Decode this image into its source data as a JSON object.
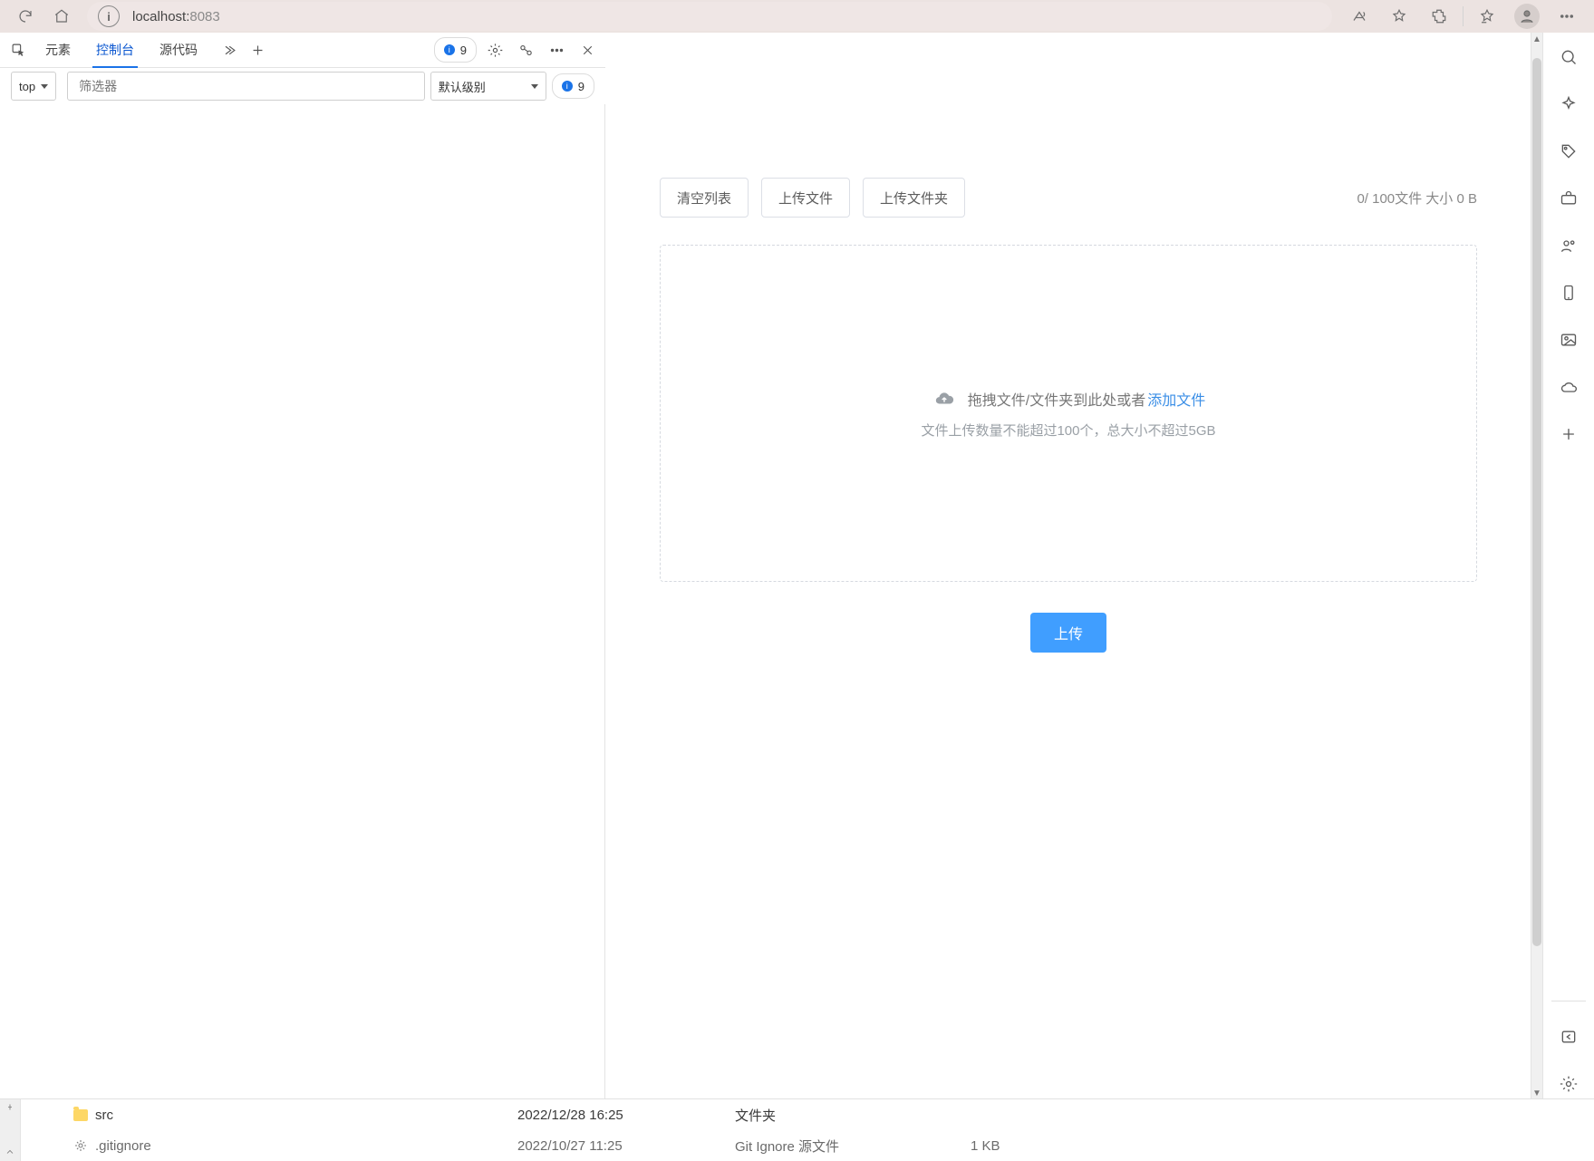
{
  "chrome": {
    "url_host": "localhost:",
    "url_port": "8083"
  },
  "devtools": {
    "tabs": {
      "elements": "元素",
      "console": "控制台",
      "sources": "源代码"
    },
    "badge_main": "9",
    "sub": {
      "context": "top",
      "filter_placeholder": "筛选器",
      "level": "默认级别",
      "badge": "9"
    }
  },
  "uploader": {
    "clear": "清空列表",
    "up_file": "上传文件",
    "up_dir": "上传文件夹",
    "counter": "0/ 100文件   大小 0 B",
    "drag_hint": "拖拽文件/文件夹到此处或者",
    "add_link": "添加文件",
    "limit_hint": "文件上传数量不能超过100个，总大小不超过5GB",
    "submit": "上传"
  },
  "explorer": {
    "rows": [
      {
        "name": "src",
        "date": "2022/12/28 16:25",
        "type": "文件夹",
        "size": ""
      },
      {
        "name": ".gitignore",
        "date": "2022/10/27 11:25",
        "type": "Git Ignore 源文件",
        "size": "1 KB"
      }
    ]
  }
}
